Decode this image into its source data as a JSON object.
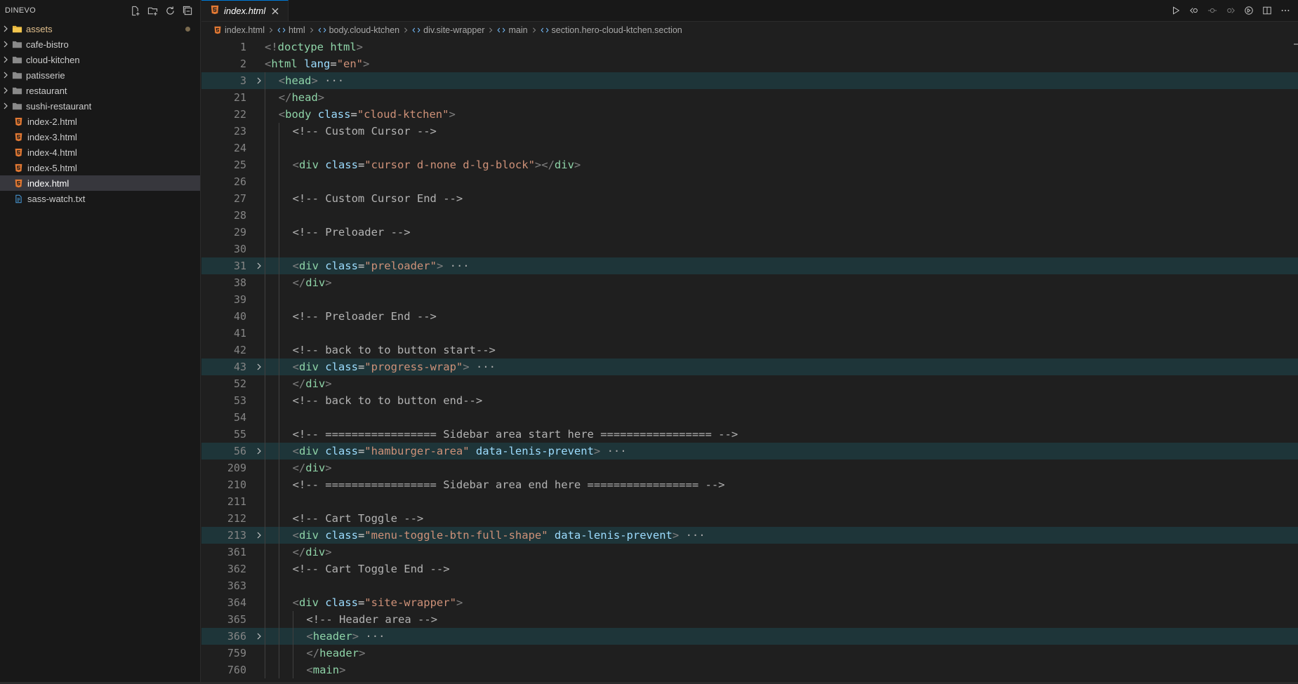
{
  "explorer": {
    "title": "DINEVO",
    "items": [
      {
        "type": "folder",
        "label": "assets",
        "modified": true
      },
      {
        "type": "folder",
        "label": "cafe-bistro"
      },
      {
        "type": "folder",
        "label": "cloud-kitchen"
      },
      {
        "type": "folder",
        "label": "patisserie"
      },
      {
        "type": "folder",
        "label": "restaurant"
      },
      {
        "type": "folder",
        "label": "sushi-restaurant"
      },
      {
        "type": "html",
        "label": "index-2.html"
      },
      {
        "type": "html",
        "label": "index-3.html"
      },
      {
        "type": "html",
        "label": "index-4.html"
      },
      {
        "type": "html",
        "label": "index-5.html"
      },
      {
        "type": "html",
        "label": "index.html",
        "selected": true
      },
      {
        "type": "txt",
        "label": "sass-watch.txt"
      }
    ]
  },
  "tab": {
    "label": "index.html"
  },
  "breadcrumb": [
    "index.html",
    "html",
    "body.cloud-ktchen",
    "div.site-wrapper",
    "main",
    "section.hero-cloud-ktchen.section"
  ],
  "lines": [
    {
      "n": "1",
      "indent": 0,
      "tokens": [
        [
          "punc",
          "<!"
        ],
        [
          "tag",
          "doctype"
        ],
        [
          "tag",
          " html"
        ],
        [
          "punc",
          ">"
        ]
      ]
    },
    {
      "n": "2",
      "indent": 0,
      "tokens": [
        [
          "punc",
          "<"
        ],
        [
          "tag",
          "html"
        ],
        [
          "attr",
          " lang"
        ],
        [
          "eq",
          "="
        ],
        [
          "str",
          "\"en\""
        ],
        [
          "punc",
          ">"
        ]
      ]
    },
    {
      "n": "3",
      "indent": 1,
      "fold": true,
      "tokens": [
        [
          "punc",
          "<"
        ],
        [
          "tag",
          "head"
        ],
        [
          "punc",
          ">"
        ],
        [
          "ell",
          " ···"
        ]
      ]
    },
    {
      "n": "21",
      "indent": 1,
      "tokens": [
        [
          "punc",
          "</"
        ],
        [
          "tag",
          "head"
        ],
        [
          "punc",
          ">"
        ]
      ]
    },
    {
      "n": "22",
      "indent": 1,
      "tokens": [
        [
          "punc",
          "<"
        ],
        [
          "tag",
          "body"
        ],
        [
          "attr",
          " class"
        ],
        [
          "eq",
          "="
        ],
        [
          "str",
          "\"cloud-ktchen\""
        ],
        [
          "punc",
          ">"
        ]
      ]
    },
    {
      "n": "23",
      "indent": 2,
      "tokens": [
        [
          "com",
          "<!-- Custom Cursor -->"
        ]
      ]
    },
    {
      "n": "24",
      "indent": 2,
      "tokens": []
    },
    {
      "n": "25",
      "indent": 2,
      "tokens": [
        [
          "punc",
          "<"
        ],
        [
          "tag",
          "div"
        ],
        [
          "attr",
          " class"
        ],
        [
          "eq",
          "="
        ],
        [
          "str",
          "\"cursor d-none d-lg-block\""
        ],
        [
          "punc",
          "></"
        ],
        [
          "tag",
          "div"
        ],
        [
          "punc",
          ">"
        ]
      ]
    },
    {
      "n": "26",
      "indent": 2,
      "tokens": []
    },
    {
      "n": "27",
      "indent": 2,
      "tokens": [
        [
          "com",
          "<!-- Custom Cursor End -->"
        ]
      ]
    },
    {
      "n": "28",
      "indent": 2,
      "tokens": []
    },
    {
      "n": "29",
      "indent": 2,
      "tokens": [
        [
          "com",
          "<!-- Preloader -->"
        ]
      ]
    },
    {
      "n": "30",
      "indent": 2,
      "tokens": []
    },
    {
      "n": "31",
      "indent": 2,
      "fold": true,
      "tokens": [
        [
          "punc",
          "<"
        ],
        [
          "tag",
          "div"
        ],
        [
          "attr",
          " class"
        ],
        [
          "eq",
          "="
        ],
        [
          "str",
          "\"preloader\""
        ],
        [
          "punc",
          ">"
        ],
        [
          "ell",
          " ···"
        ]
      ]
    },
    {
      "n": "38",
      "indent": 2,
      "tokens": [
        [
          "punc",
          "</"
        ],
        [
          "tag",
          "div"
        ],
        [
          "punc",
          ">"
        ]
      ]
    },
    {
      "n": "39",
      "indent": 2,
      "tokens": []
    },
    {
      "n": "40",
      "indent": 2,
      "tokens": [
        [
          "com",
          "<!-- Preloader End -->"
        ]
      ]
    },
    {
      "n": "41",
      "indent": 2,
      "tokens": []
    },
    {
      "n": "42",
      "indent": 2,
      "tokens": [
        [
          "com",
          "<!-- back to to button start-->"
        ]
      ]
    },
    {
      "n": "43",
      "indent": 2,
      "fold": true,
      "tokens": [
        [
          "punc",
          "<"
        ],
        [
          "tag",
          "div"
        ],
        [
          "attr",
          " class"
        ],
        [
          "eq",
          "="
        ],
        [
          "str",
          "\"progress-wrap\""
        ],
        [
          "punc",
          ">"
        ],
        [
          "ell",
          " ···"
        ]
      ]
    },
    {
      "n": "52",
      "indent": 2,
      "tokens": [
        [
          "punc",
          "</"
        ],
        [
          "tag",
          "div"
        ],
        [
          "punc",
          ">"
        ]
      ]
    },
    {
      "n": "53",
      "indent": 2,
      "tokens": [
        [
          "com",
          "<!-- back to to button end-->"
        ]
      ]
    },
    {
      "n": "54",
      "indent": 2,
      "tokens": []
    },
    {
      "n": "55",
      "indent": 2,
      "tokens": [
        [
          "com",
          "<!-- ================= Sidebar area start here ================= -->"
        ]
      ]
    },
    {
      "n": "56",
      "indent": 2,
      "fold": true,
      "tokens": [
        [
          "punc",
          "<"
        ],
        [
          "tag",
          "div"
        ],
        [
          "attr",
          " class"
        ],
        [
          "eq",
          "="
        ],
        [
          "str",
          "\"hamburger-area\""
        ],
        [
          "attr",
          " data-lenis-prevent"
        ],
        [
          "punc",
          ">"
        ],
        [
          "ell",
          " ···"
        ]
      ]
    },
    {
      "n": "209",
      "indent": 2,
      "tokens": [
        [
          "punc",
          "</"
        ],
        [
          "tag",
          "div"
        ],
        [
          "punc",
          ">"
        ]
      ]
    },
    {
      "n": "210",
      "indent": 2,
      "tokens": [
        [
          "com",
          "<!-- ================= Sidebar area end here ================= -->"
        ]
      ]
    },
    {
      "n": "211",
      "indent": 2,
      "tokens": []
    },
    {
      "n": "212",
      "indent": 2,
      "tokens": [
        [
          "com",
          "<!-- Cart Toggle -->"
        ]
      ]
    },
    {
      "n": "213",
      "indent": 2,
      "fold": true,
      "tokens": [
        [
          "punc",
          "<"
        ],
        [
          "tag",
          "div"
        ],
        [
          "attr",
          " class"
        ],
        [
          "eq",
          "="
        ],
        [
          "str",
          "\"menu-toggle-btn-full-shape\""
        ],
        [
          "attr",
          " data-lenis-prevent"
        ],
        [
          "punc",
          ">"
        ],
        [
          "ell",
          " ···"
        ]
      ]
    },
    {
      "n": "361",
      "indent": 2,
      "tokens": [
        [
          "punc",
          "</"
        ],
        [
          "tag",
          "div"
        ],
        [
          "punc",
          ">"
        ]
      ]
    },
    {
      "n": "362",
      "indent": 2,
      "tokens": [
        [
          "com",
          "<!-- Cart Toggle End -->"
        ]
      ]
    },
    {
      "n": "363",
      "indent": 2,
      "tokens": []
    },
    {
      "n": "364",
      "indent": 2,
      "tokens": [
        [
          "punc",
          "<"
        ],
        [
          "tag",
          "div"
        ],
        [
          "attr",
          " class"
        ],
        [
          "eq",
          "="
        ],
        [
          "str",
          "\"site-wrapper\""
        ],
        [
          "punc",
          ">"
        ]
      ]
    },
    {
      "n": "365",
      "indent": 3,
      "tokens": [
        [
          "com",
          "<!-- Header area -->"
        ]
      ]
    },
    {
      "n": "366",
      "indent": 3,
      "fold": true,
      "tokens": [
        [
          "punc",
          "<"
        ],
        [
          "tag",
          "header"
        ],
        [
          "punc",
          ">"
        ],
        [
          "ell",
          " ···"
        ]
      ]
    },
    {
      "n": "759",
      "indent": 3,
      "tokens": [
        [
          "punc",
          "</"
        ],
        [
          "tag",
          "header"
        ],
        [
          "punc",
          ">"
        ]
      ]
    },
    {
      "n": "760",
      "indent": 3,
      "tokens": [
        [
          "punc",
          "<"
        ],
        [
          "tag",
          "main"
        ],
        [
          "punc",
          ">"
        ]
      ]
    }
  ]
}
